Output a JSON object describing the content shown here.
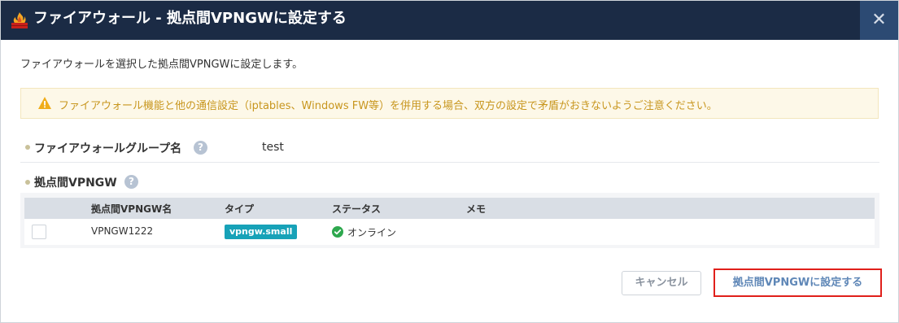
{
  "dialog": {
    "title": "ファイアウォール - 拠点間VPNGWに設定する",
    "close_label": "✕"
  },
  "description": "ファイアウォールを選択した拠点間VPNGWに設定します。",
  "warning": {
    "icon": "warning-triangle-icon",
    "text": "ファイアウォール機能と他の通信設定（iptables、Windows FW等）を併用する場合、双方の設定で矛盾がおきないようご注意ください。",
    "color": "#c8961e"
  },
  "firewall_group": {
    "label": "ファイアウォールグループ名",
    "help": "?",
    "value": "test"
  },
  "vpngw_section": {
    "label": "拠点間VPNGW",
    "help": "?"
  },
  "table": {
    "columns": [
      "拠点間VPNGW名",
      "タイプ",
      "ステータス",
      "メモ"
    ],
    "rows": [
      {
        "name": "VPNGW1222",
        "type": "vpngw.small",
        "status": "オンライン",
        "memo": "",
        "checked": false
      }
    ]
  },
  "buttons": {
    "cancel": "キャンセル",
    "submit": "拠点間VPNGWに設定する"
  },
  "colors": {
    "header_bg": "#1b2b45",
    "badge_bg": "#17a2b8",
    "status_ok": "#2ea84e",
    "highlight": "#e0201b"
  }
}
